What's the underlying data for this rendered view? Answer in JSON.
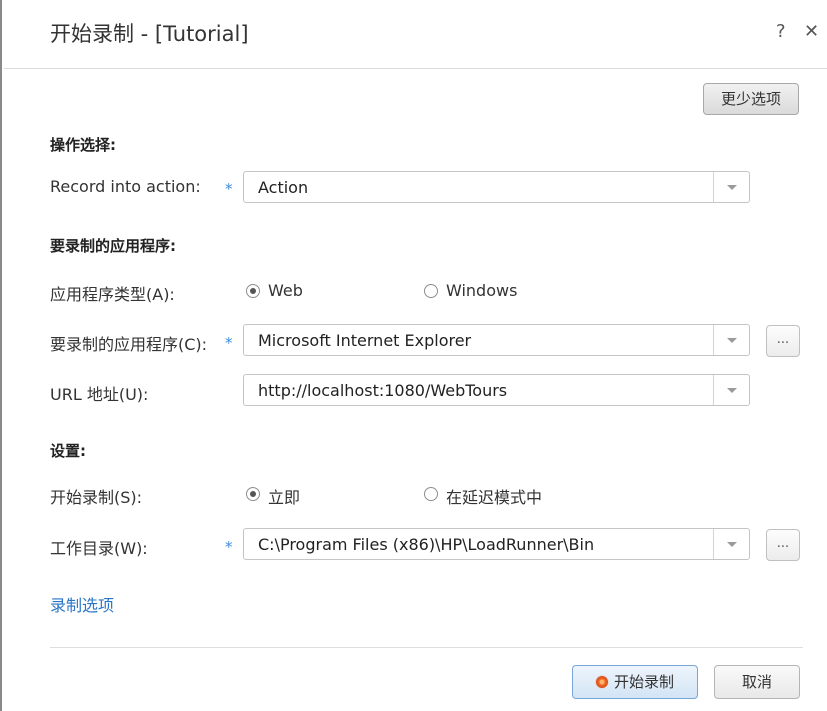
{
  "window": {
    "title": "开始录制 - [Tutorial]",
    "help_icon": "question-mark-icon",
    "close_icon": "close-icon"
  },
  "toolbar": {
    "less_options_label": "更少选项"
  },
  "operation_section": {
    "title": "操作选择:",
    "record_into_action": {
      "label": "Record into action:",
      "value": "Action",
      "required": "*"
    }
  },
  "app_section": {
    "title": "要录制的应用程序:",
    "app_type": {
      "label": "应用程序类型(A):",
      "options": [
        "Web",
        "Windows"
      ],
      "selected": "Web"
    },
    "app_to_record": {
      "label": "要录制的应用程序(C):",
      "value": "Microsoft Internet Explorer",
      "required": "*",
      "browse_label": "..."
    },
    "url": {
      "label": "URL 地址(U):",
      "value": "http://localhost:1080/WebTours"
    }
  },
  "settings_section": {
    "title": "设置:",
    "start_recording": {
      "label": "开始录制(S):",
      "options": [
        "立即",
        "在延迟模式中"
      ],
      "selected": "立即"
    },
    "working_dir": {
      "label": "工作目录(W):",
      "value": "C:\\Program Files (x86)\\HP\\LoadRunner\\Bin",
      "required": "*",
      "browse_label": "..."
    }
  },
  "recording_options_link": "录制选项",
  "footer": {
    "start_label": "开始录制",
    "cancel_label": "取消"
  },
  "colors": {
    "link": "#2a76c6",
    "required_marker": "#3c8be0",
    "primary_button_border": "#7aa6d6",
    "record_dot": "#f06a28"
  }
}
